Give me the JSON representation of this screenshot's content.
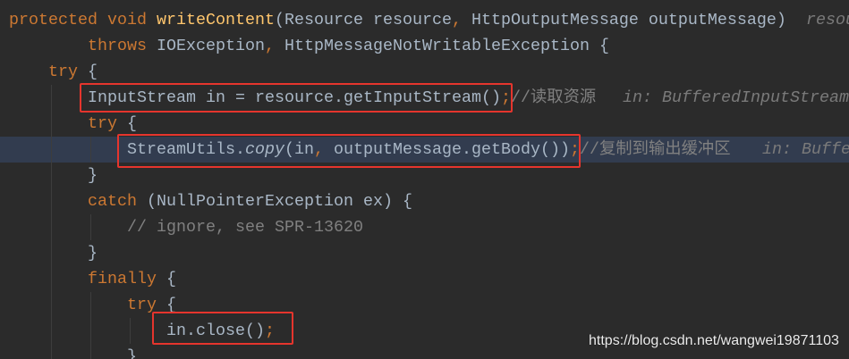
{
  "colors": {
    "background": "#2B2B2B",
    "keyword": "#CC7832",
    "method_declaration": "#FFC66D",
    "text": "#A9B7C6",
    "comment": "#808080",
    "inline_value": "#7A7A7A",
    "current_line": "#323C4F",
    "highlight_box": "#E5352D",
    "indent_guide": "#3D3D3D",
    "watermark_text": "#EDEDED"
  },
  "code": {
    "lines": [
      {
        "tokens": [
          "protected void ",
          "writeContent",
          "(Resource resource",
          ",",
          " HttpOutputMessage outputMessage)"
        ],
        "inline_value": "resou"
      },
      {
        "tokens": [
          "throws ",
          "IOException",
          ",",
          " HttpMessageNotWritableException {"
        ]
      },
      {
        "tokens": [
          "try ",
          "{"
        ]
      },
      {
        "tokens": [
          "InputStream in = resource.getInputStream()",
          ";",
          "//读取资源"
        ],
        "inline_value": "in: BufferedInputStream"
      },
      {
        "tokens": [
          "try ",
          "{"
        ]
      },
      {
        "tokens": [
          "StreamUtils.",
          "copy",
          "(in",
          ",",
          " outputMessage.getBody())",
          ";",
          "//复制到输出缓冲区"
        ],
        "inline_value": "in: Buffe"
      },
      {
        "tokens": [
          "}"
        ]
      },
      {
        "tokens": [
          "catch ",
          "(NullPointerException ex) {"
        ]
      },
      {
        "tokens": [
          "// ignore, see SPR-13620"
        ]
      },
      {
        "tokens": [
          "}"
        ]
      },
      {
        "tokens": [
          "finally ",
          "{"
        ]
      },
      {
        "tokens": [
          "try ",
          "{"
        ]
      },
      {
        "tokens": [
          "in.close()",
          ";"
        ]
      },
      {
        "tokens": [
          "}"
        ]
      }
    ]
  },
  "watermark": {
    "text": "https://blog.csdn.net/wangwei19871103"
  }
}
